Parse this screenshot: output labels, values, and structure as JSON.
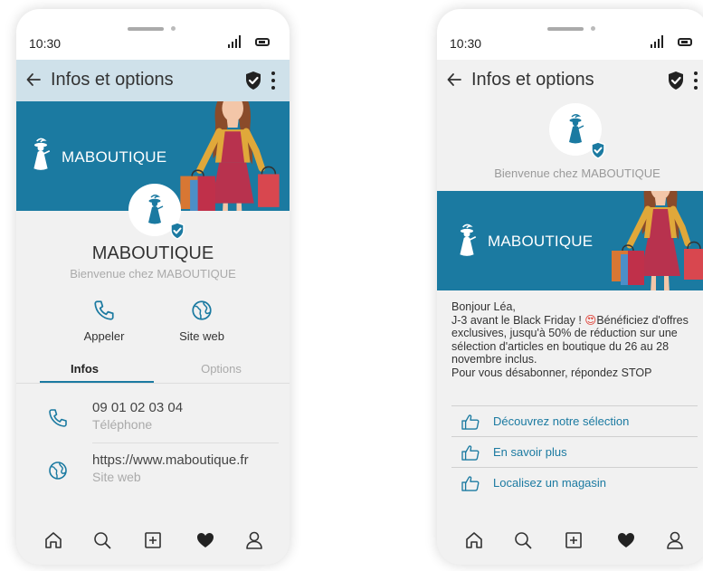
{
  "status_bar": {
    "time": "10:30"
  },
  "app_bar": {
    "title": "Infos et options"
  },
  "brand": {
    "name": "MABOUTIQUE",
    "welcome": "Bienvenue chez MABOUTIQUE"
  },
  "profile_screen": {
    "actions": [
      {
        "label": "Appeler"
      },
      {
        "label": "Site web"
      }
    ],
    "tabs": [
      {
        "label": "Infos",
        "active": true
      },
      {
        "label": "Options",
        "active": false
      }
    ],
    "info_rows": [
      {
        "value": "09 01 02 03 04",
        "label": "Téléphone"
      },
      {
        "value": "https://www.maboutique.fr",
        "label": "Site web"
      }
    ]
  },
  "message_screen": {
    "greeting": "Bonjour Léa,",
    "body_part1": "J-3 avant le Black Friday ! ",
    "body_part2": "Bénéficiez d'offres exclusives, jusqu'à 50% de réduction sur une sélection d'articles en boutique du 26 au 28 novembre inclus.",
    "footer": "Pour vous désabonner, répondez STOP",
    "links": [
      {
        "label": "Découvrez notre sélection"
      },
      {
        "label": "En savoir plus"
      },
      {
        "label": "Localisez un magasin"
      }
    ]
  },
  "bottom_nav": [
    "home-icon",
    "search-icon",
    "add-icon",
    "heart-icon",
    "profile-icon"
  ],
  "colors": {
    "accent": "#1b7aa1",
    "header_left": "#cfe1ea",
    "background": "#f1f1f1"
  }
}
